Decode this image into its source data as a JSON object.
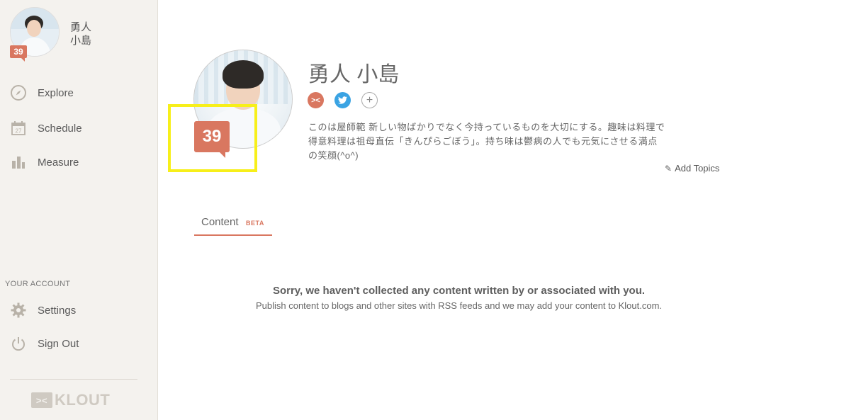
{
  "sidebar": {
    "user": {
      "name_line1": "勇人",
      "name_line2": "小島",
      "score": "39"
    },
    "nav": [
      {
        "label": "Explore",
        "icon": "compass-icon"
      },
      {
        "label": "Schedule",
        "icon": "calendar-icon",
        "icon_text": "27"
      },
      {
        "label": "Measure",
        "icon": "bar-chart-icon"
      }
    ],
    "account_label": "YOUR ACCOUNT",
    "account_items": [
      {
        "label": "Settings",
        "icon": "gear-icon"
      },
      {
        "label": "Sign Out",
        "icon": "power-icon"
      }
    ],
    "logo_text": "KLOUT"
  },
  "profile": {
    "name": "勇人 小島",
    "score": "39",
    "bio": "このは屋師範 新しい物ばかりでなく今持っているものを大切にする。趣味は料理で得意料理は祖母直伝「きんぴらごぼう」。持ち味は鬱病の人でも元気にさせる満点の笑顔(^o^)",
    "add_topics": "Add Topics",
    "social": [
      "klout-icon",
      "twitter-icon",
      "add-network-icon"
    ]
  },
  "tabs": [
    {
      "label": "Content",
      "badge": "BETA"
    }
  ],
  "empty_state": {
    "title": "Sorry, we haven't collected any content written by or associated with you.",
    "subtitle": "Publish content to blogs and other sites with RSS feeds and we may add your content to Klout.com."
  },
  "colors": {
    "accent": "#d97760",
    "sidebar_bg": "#f4f2ee",
    "highlight": "#f7ef1a",
    "twitter": "#3aa3e3"
  }
}
